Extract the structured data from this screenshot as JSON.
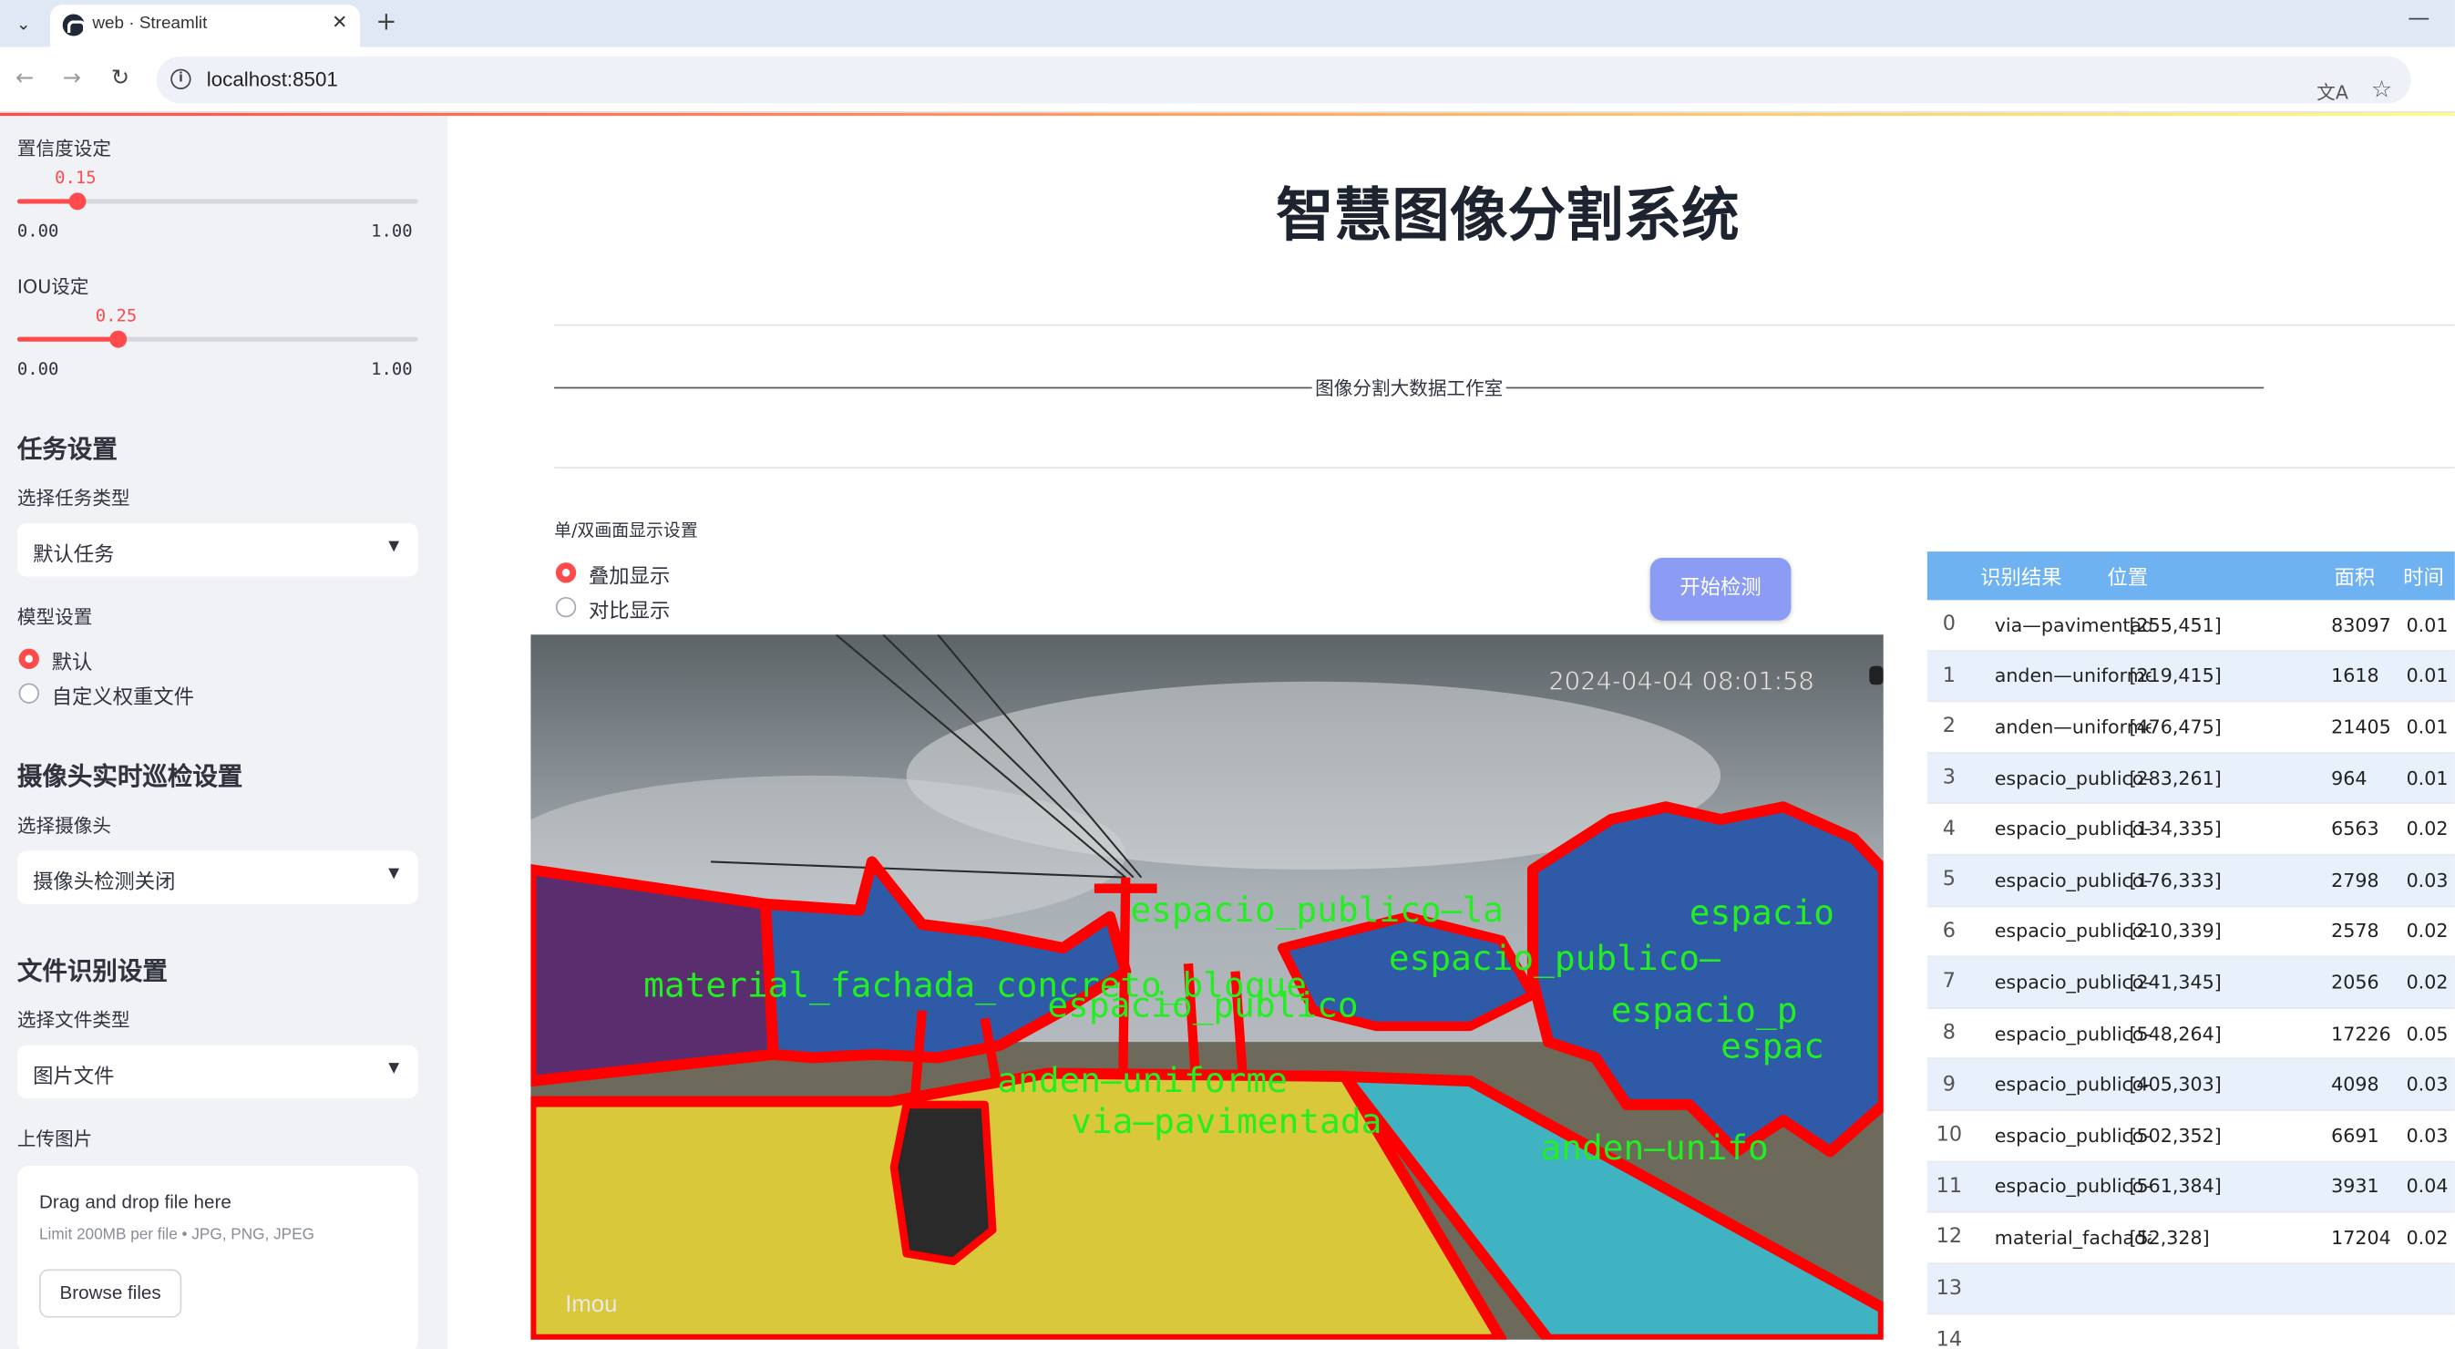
{
  "browser": {
    "tab_title": "web · Streamlit",
    "url": "localhost:8501"
  },
  "sidebar": {
    "confidence": {
      "label": "置信度设定",
      "value": "0.15",
      "fraction": 0.15,
      "min": "0.00",
      "max": "1.00"
    },
    "iou": {
      "label": "IOU设定",
      "value": "0.25",
      "fraction": 0.25,
      "min": "0.00",
      "max": "1.00"
    },
    "task_section": "任务设置",
    "task_type_label": "选择任务类型",
    "task_type_value": "默认任务",
    "model_label": "模型设置",
    "model_options": [
      "默认",
      "自定义权重文件"
    ],
    "model_selected": 0,
    "camera_section": "摄像头实时巡检设置",
    "camera_label": "选择摄像头",
    "camera_value": "摄像头检测关闭",
    "file_section": "文件识别设置",
    "file_type_label": "选择文件类型",
    "file_type_value": "图片文件",
    "upload_label": "上传图片",
    "upload_title": "Drag and drop file here",
    "upload_limit": "Limit 200MB per file • JPG, PNG, JPEG",
    "browse_label": "Browse files"
  },
  "main": {
    "title": "智慧图像分割系统",
    "studio_text": "图像分割大数据工作室",
    "display_mode_label": "单/双画面显示设置",
    "display_modes": [
      "叠加显示",
      "对比显示"
    ],
    "display_selected": 0,
    "start_button": "开始检测",
    "image": {
      "timestamp": "2024-04-04 08:01:58",
      "watermark": "Imou",
      "overlay_labels": [
        "espacio_publico—la",
        "espacio",
        "espacio_publico—",
        "material_fachada_concreto_bloque",
        "espacio_publico",
        "espacio_p",
        "espac",
        "anden—uniforme",
        "via—pavimentada",
        "anden—unifo"
      ]
    }
  },
  "table": {
    "headers": [
      "识别结果",
      "位置",
      "面积",
      "时间"
    ],
    "rows": [
      {
        "idx": "0",
        "name": "via—pavimentada",
        "pos": "[255,451]",
        "area": "83097",
        "time": "0.01"
      },
      {
        "idx": "1",
        "name": "anden—uniforme",
        "pos": "[219,415]",
        "area": "1618",
        "time": "0.01"
      },
      {
        "idx": "2",
        "name": "anden—uniforme",
        "pos": "[476,475]",
        "area": "21405",
        "time": "0.01"
      },
      {
        "idx": "3",
        "name": "espacio_publico—arbol_poste",
        "pos": "[283,261]",
        "area": "964",
        "time": "0.01"
      },
      {
        "idx": "4",
        "name": "espacio_publico—arbol",
        "pos": "[134,335]",
        "area": "6563",
        "time": "0.02"
      },
      {
        "idx": "5",
        "name": "espacio_publico—arbol",
        "pos": "[176,333]",
        "area": "2798",
        "time": "0.03"
      },
      {
        "idx": "6",
        "name": "espacio_publico—arbol",
        "pos": "[210,339]",
        "area": "2578",
        "time": "0.02"
      },
      {
        "idx": "7",
        "name": "espacio_publico—arbol",
        "pos": "[241,345]",
        "area": "2056",
        "time": "0.02"
      },
      {
        "idx": "8",
        "name": "espacio_publico—arbol",
        "pos": "[548,264]",
        "area": "17226",
        "time": "0.05"
      },
      {
        "idx": "9",
        "name": "espacio_publico—arbol",
        "pos": "[405,303]",
        "area": "4098",
        "time": "0.03"
      },
      {
        "idx": "10",
        "name": "espacio_publico—arbol",
        "pos": "[502,352]",
        "area": "6691",
        "time": "0.03"
      },
      {
        "idx": "11",
        "name": "espacio_publico—arbol",
        "pos": "[561,384]",
        "area": "3931",
        "time": "0.04"
      },
      {
        "idx": "12",
        "name": "material_fachada_concreto_bloque",
        "pos": "[52,328]",
        "area": "17204",
        "time": "0.02"
      },
      {
        "idx": "13",
        "name": "",
        "pos": "",
        "area": "",
        "time": ""
      },
      {
        "idx": "14",
        "name": "",
        "pos": "",
        "area": "",
        "time": ""
      }
    ]
  },
  "colors": {
    "accent": "#ff4b4b",
    "button": "#8c9cf5",
    "table_header": "#6fb2f2",
    "mask_road": "#d9c83a",
    "mask_sidewalk": "#3fb3c2",
    "mask_tree": "#2f5aa8",
    "mask_facade": "#5a2d6e",
    "outline": "#ff0000",
    "label_text": "#22ee22"
  }
}
